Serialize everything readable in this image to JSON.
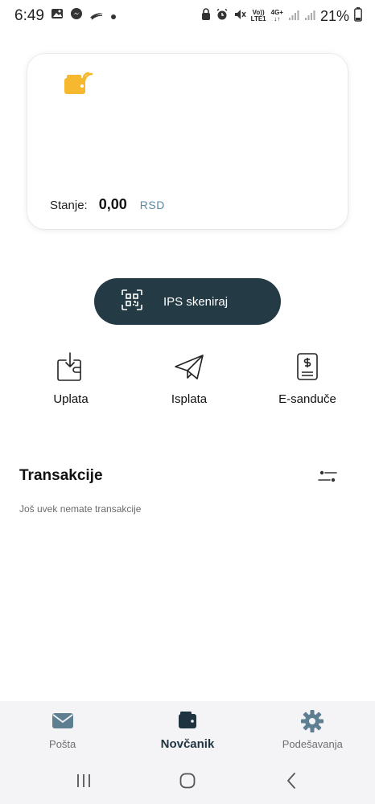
{
  "status_bar": {
    "time": "6:49",
    "battery": "21%",
    "network_top": "4G+",
    "volte_top": "Vo))",
    "volte_bottom": "LTE1"
  },
  "wallet": {
    "balance_label": "Stanje:",
    "balance_amount": "0,00",
    "currency": "RSD",
    "icon": "wallet-nfc-icon",
    "accent_color": "#f5b82e"
  },
  "ips_button": {
    "label": "IPS skeniraj",
    "icon": "qr-code-icon",
    "color": "#243a45"
  },
  "actions": [
    {
      "label": "Uplata",
      "icon": "wallet-download-icon"
    },
    {
      "label": "Isplata",
      "icon": "paper-plane-icon"
    },
    {
      "label": "E-sanduče",
      "icon": "invoice-dollar-icon"
    }
  ],
  "transactions": {
    "title": "Transakcije",
    "empty_message": "Još uvek nemate transakcije",
    "filter_icon": "filter-sliders-icon"
  },
  "bottom_nav": [
    {
      "label": "Pošta",
      "icon": "mail-icon",
      "active": false
    },
    {
      "label": "Novčanik",
      "icon": "wallet-icon",
      "active": true
    },
    {
      "label": "Podešavanja",
      "icon": "gear-icon",
      "active": false
    }
  ],
  "system_nav": {
    "recents": "recents-icon",
    "home": "home-icon",
    "back": "back-icon"
  }
}
